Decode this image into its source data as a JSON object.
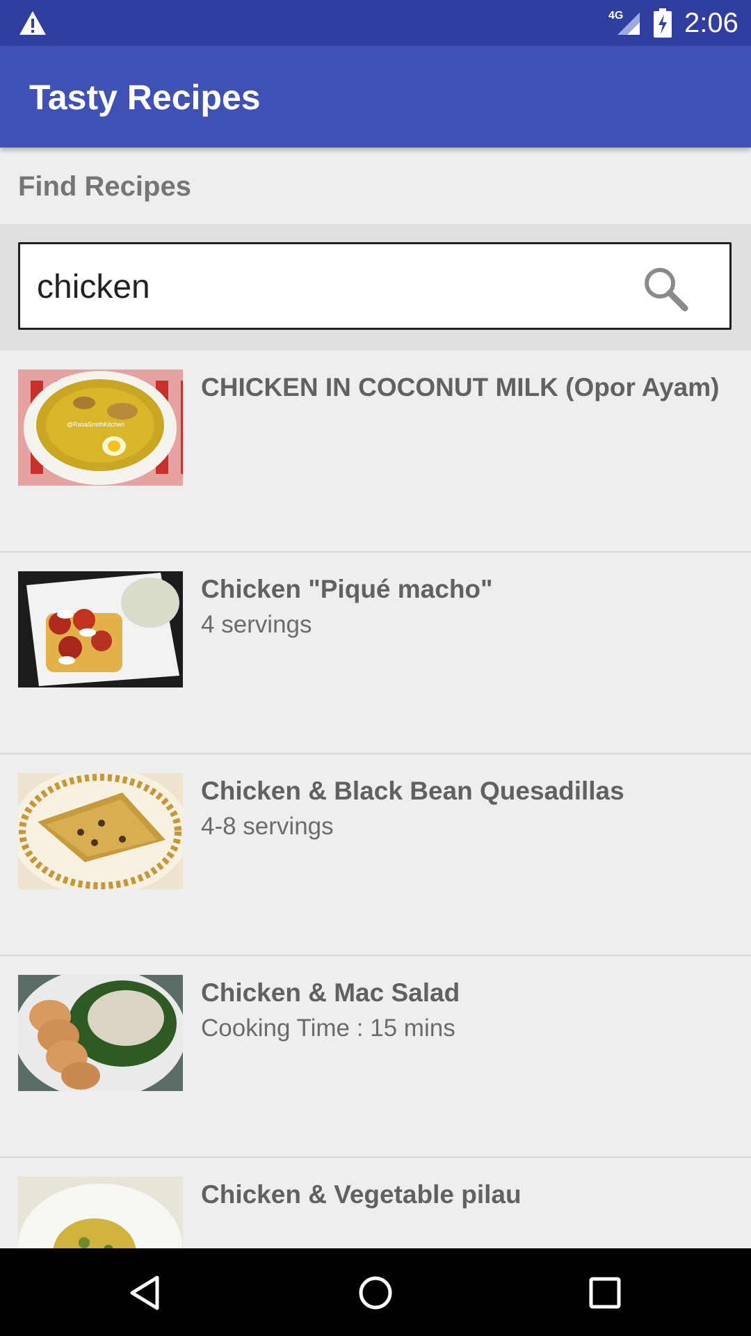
{
  "status_bar": {
    "network": "4G",
    "time": "2:06",
    "icons": [
      "warning-icon",
      "signal-icon",
      "battery-charging-icon"
    ]
  },
  "app_bar": {
    "title": "Tasty Recipes"
  },
  "section": {
    "heading": "Find Recipes"
  },
  "search": {
    "value": "chicken",
    "icon": "search-icon"
  },
  "recipes": [
    {
      "name": "CHICKEN IN COCONUT MILK (Opor Ayam)",
      "meta": "",
      "watermark": "@RasaSmithKitchen"
    },
    {
      "name": "Chicken \"Piqué macho\"",
      "meta": "4 servings"
    },
    {
      "name": "Chicken & Black Bean Quesadillas",
      "meta": "4-8 servings"
    },
    {
      "name": "Chicken & Mac Salad",
      "meta": "Cooking Time : 15 mins"
    },
    {
      "name": "Chicken & Vegetable pilau",
      "meta": ""
    }
  ],
  "nav_bar": {
    "icons": [
      "back-icon",
      "home-icon",
      "recents-icon"
    ]
  },
  "colors": {
    "status_bar": "#303f9f",
    "app_bar": "#3f51b5",
    "background": "#eeeeee",
    "search_band": "#e0e0e0"
  }
}
